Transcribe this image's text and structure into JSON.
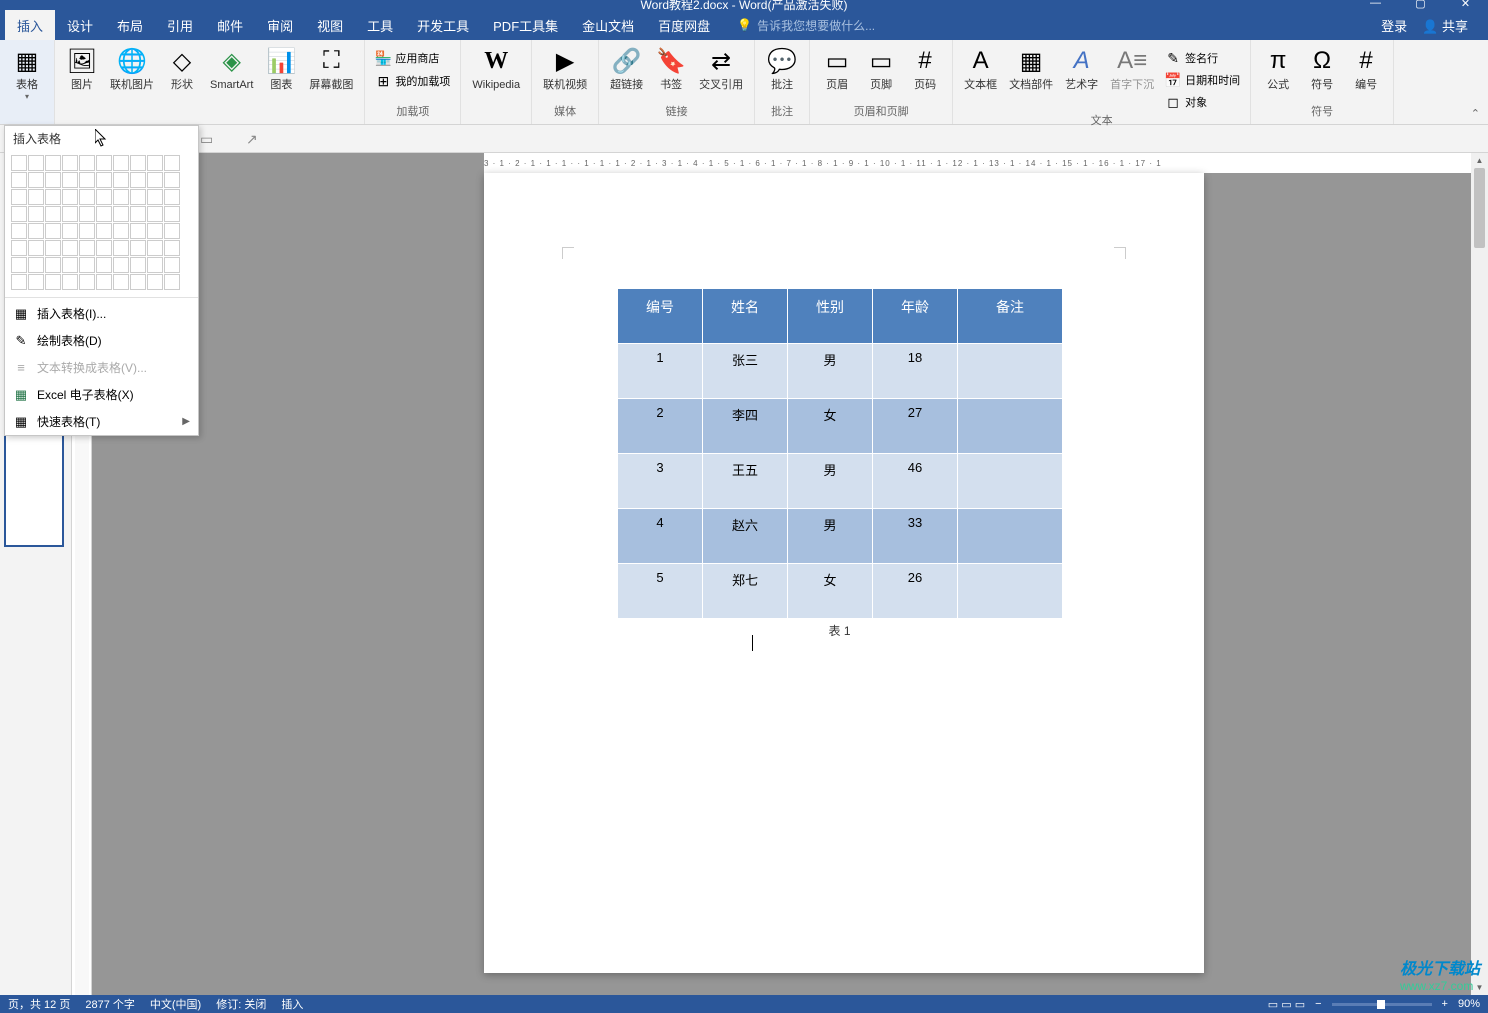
{
  "titlebar": {
    "title": "Word教程2.docx - Word(产品激活失败)"
  },
  "menubar": {
    "tabs": [
      "插入",
      "设计",
      "布局",
      "引用",
      "邮件",
      "审阅",
      "视图",
      "工具",
      "开发工具",
      "PDF工具集",
      "金山文档",
      "百度网盘"
    ],
    "active_tab": 0,
    "tell_me": "告诉我您想要做什么...",
    "login": "登录",
    "share": "共享"
  },
  "ribbon": {
    "groups": {
      "table": {
        "label": "表格",
        "btn": "表格"
      },
      "illustrations": {
        "pic": "图片",
        "online_pic": "联机图片",
        "shapes": "形状",
        "smartart": "SmartArt",
        "chart": "图表",
        "screenshot": "屏幕截图"
      },
      "addins": {
        "label": "加载项",
        "store": "应用商店",
        "my_addins": "我的加载项",
        "wikipedia": "Wikipedia"
      },
      "media": {
        "label": "媒体",
        "online_video": "联机视频"
      },
      "links": {
        "label": "链接",
        "hyperlink": "超链接",
        "bookmark": "书签",
        "crossref": "交叉引用"
      },
      "comments": {
        "label": "批注",
        "comment": "批注"
      },
      "headerfooter": {
        "label": "页眉和页脚",
        "header": "页眉",
        "footer": "页脚",
        "pagenum": "页码"
      },
      "text": {
        "label": "文本",
        "textbox": "文本框",
        "quickparts": "文档部件",
        "wordart": "艺术字",
        "dropcap": "首字下沉",
        "signature": "签名行",
        "datetime": "日期和时间",
        "object": "对象"
      },
      "symbols": {
        "label": "符号",
        "equation": "公式",
        "symbol": "符号",
        "number": "编号"
      }
    }
  },
  "table_dropdown": {
    "title": "插入表格",
    "items": {
      "insert": "插入表格(I)...",
      "draw": "绘制表格(D)",
      "convert": "文本转换成表格(V)...",
      "excel": "Excel 电子表格(X)",
      "quick": "快速表格(T)"
    }
  },
  "document": {
    "table": {
      "headers": [
        "编号",
        "姓名",
        "性别",
        "年龄",
        "备注"
      ],
      "rows": [
        [
          "1",
          "张三",
          "男",
          "18",
          ""
        ],
        [
          "2",
          "李四",
          "女",
          "27",
          ""
        ],
        [
          "3",
          "王五",
          "男",
          "46",
          ""
        ],
        [
          "4",
          "赵六",
          "男",
          "33",
          ""
        ],
        [
          "5",
          "郑七",
          "女",
          "26",
          ""
        ]
      ]
    },
    "caption": "表 1"
  },
  "ruler_h": "3 · 1 · 2 · 1 · 1 · 1 ·  · 1 · 1 · 1 · 2 · 1 · 3 · 1 · 4 · 1 · 5 · 1 · 6 · 1 · 7 · 1 · 8 · 1 · 9 · 1 · 10 · 1 · 11 · 1 · 12 · 1 · 13 · 1 · 14 · 1 · 15 · 1 · 16 · 1 · 17 · 1",
  "statusbar": {
    "page": "页，共 12 页",
    "words": "2877 个字",
    "lang": "中文(中国)",
    "track": "修订: 关闭",
    "mode": "插入",
    "zoom": "90%"
  },
  "watermark": {
    "line1": "极光下载站",
    "line2": "www.xz7.com"
  }
}
